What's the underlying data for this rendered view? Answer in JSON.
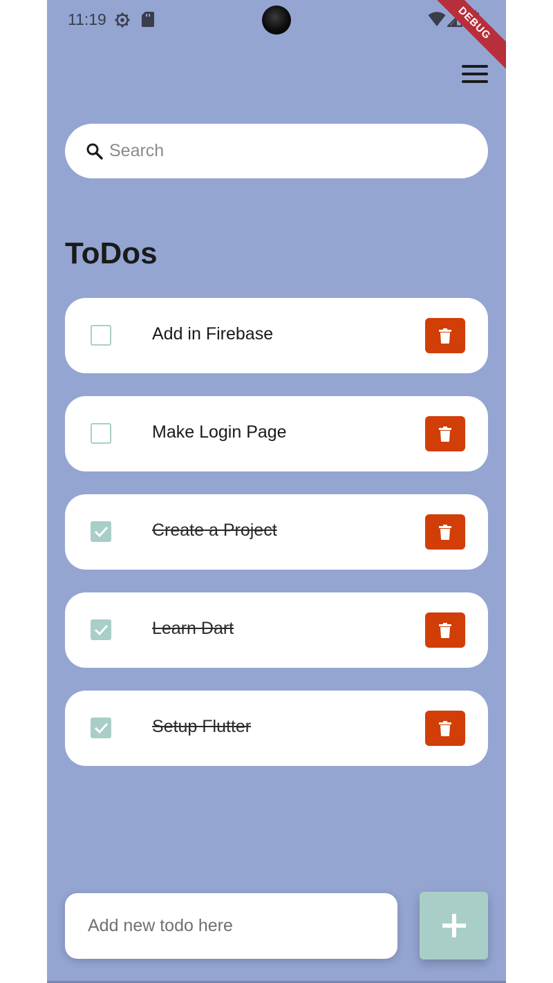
{
  "status_bar": {
    "time": "11:19",
    "icons": [
      "settings-gear-icon",
      "sd-card-icon",
      "wifi-icon",
      "cell-signal-icon",
      "battery-icon"
    ],
    "debug_label": "DEBUG"
  },
  "header": {
    "menu_icon": "hamburger-menu-icon"
  },
  "search": {
    "placeholder": "Search",
    "value": "",
    "icon": "search-icon"
  },
  "page": {
    "title": "ToDos"
  },
  "todos": [
    {
      "text": "Add in Firebase",
      "done": false
    },
    {
      "text": "Make Login Page",
      "done": false
    },
    {
      "text": "Create a Project",
      "done": true
    },
    {
      "text": "Learn Dart",
      "done": true
    },
    {
      "text": "Setup Flutter",
      "done": true
    }
  ],
  "new_todo": {
    "placeholder": "Add new todo here",
    "value": "",
    "add_icon": "plus-icon"
  },
  "colors": {
    "background": "#94a5d2",
    "card": "#ffffff",
    "accent": "#a9cec7",
    "delete": "#d13e08",
    "debug_banner": "#b72f3a"
  }
}
